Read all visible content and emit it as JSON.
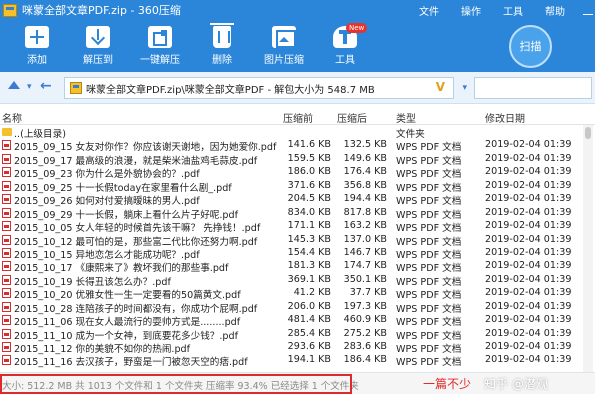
{
  "window": {
    "title": "咪蒙全部文章PDF.zip - 360压缩",
    "menus": [
      "文件",
      "操作",
      "工具",
      "帮助"
    ]
  },
  "toolbar": {
    "add": "添加",
    "extract": "解压到",
    "one_key": "一键解压",
    "delete": "删除",
    "image_compress": "图片压缩",
    "tools": "工具",
    "new_badge": "New",
    "scan": "扫描"
  },
  "address": {
    "path": "咪蒙全部文章PDF.zip\\咪蒙全部文章PDF - 解包大小为 548.7 MB",
    "v_mark": "V"
  },
  "columns": {
    "name": "名称",
    "size": "压缩前",
    "compressed": "压缩后",
    "type": "类型",
    "modified": "修改日期"
  },
  "rows": [
    {
      "icon": "folder-icon",
      "name": "..(上级目录)",
      "size": "",
      "compressed": "",
      "type": "文件夹",
      "date": ""
    },
    {
      "icon": "pdf-icon",
      "name": "2015_09_15 女友对你作？你应该谢天谢地，因为她爱你.pdf",
      "size": "141.6 KB",
      "compressed": "132.5 KB",
      "type": "WPS PDF 文档",
      "date": "2019-02-04 01:39"
    },
    {
      "icon": "pdf-icon",
      "name": "2015_09_17 最高级的浪漫，就是柴米油盐鸡毛蒜皮.pdf",
      "size": "159.5 KB",
      "compressed": "149.6 KB",
      "type": "WPS PDF 文档",
      "date": "2019-02-04 01:39"
    },
    {
      "icon": "pdf-icon",
      "name": "2015_09_23 你为什么是外貌协会的？.pdf",
      "size": "186.0 KB",
      "compressed": "176.4 KB",
      "type": "WPS PDF 文档",
      "date": "2019-02-04 01:39"
    },
    {
      "icon": "pdf-icon",
      "name": "2015_09_25 十一长假today在家里看什么剧_.pdf",
      "size": "371.6 KB",
      "compressed": "356.8 KB",
      "type": "WPS PDF 文档",
      "date": "2019-02-04 01:39"
    },
    {
      "icon": "pdf-icon",
      "name": "2015_09_26 如何对付爱搞暧昧的男人.pdf",
      "size": "204.5 KB",
      "compressed": "194.4 KB",
      "type": "WPS PDF 文档",
      "date": "2019-02-04 01:39"
    },
    {
      "icon": "pdf-icon",
      "name": "2015_09_29 十一长假，躺床上看什么片子好呢.pdf",
      "size": "834.0 KB",
      "compressed": "817.8 KB",
      "type": "WPS PDF 文档",
      "date": "2019-02-04 01:39"
    },
    {
      "icon": "pdf-icon",
      "name": "2015_10_05 女人年轻的时候首先该干嘛？ 先挣钱！.pdf",
      "size": "171.1 KB",
      "compressed": "163.2 KB",
      "type": "WPS PDF 文档",
      "date": "2019-02-04 01:39"
    },
    {
      "icon": "pdf-icon",
      "name": "2015_10_12 最可怕的是，那些富二代比你还努力啊.pdf",
      "size": "145.3 KB",
      "compressed": "137.0 KB",
      "type": "WPS PDF 文档",
      "date": "2019-02-04 01:39"
    },
    {
      "icon": "pdf-icon",
      "name": "2015_10_15 异地恋怎么才能成功呢？.pdf",
      "size": "154.4 KB",
      "compressed": "146.7 KB",
      "type": "WPS PDF 文档",
      "date": "2019-02-04 01:39"
    },
    {
      "icon": "pdf-icon",
      "name": "2015_10_17 《康熙来了》教坏我们的那些事.pdf",
      "size": "181.3 KB",
      "compressed": "174.7 KB",
      "type": "WPS PDF 文档",
      "date": "2019-02-04 01:39"
    },
    {
      "icon": "pdf-icon",
      "name": "2015_10_19 长得丑该怎么办？.pdf",
      "size": "369.1 KB",
      "compressed": "350.1 KB",
      "type": "WPS PDF 文档",
      "date": "2019-02-04 01:39"
    },
    {
      "icon": "pdf-icon",
      "name": "2015_10_20 优雅女性一生一定要看的50篇黄文.pdf",
      "size": "41.2 KB",
      "compressed": "37.7 KB",
      "type": "WPS PDF 文档",
      "date": "2019-02-04 01:39"
    },
    {
      "icon": "pdf-icon",
      "name": "2015_10_28 连陪孩子的时间都没有，你成功个屁啊.pdf",
      "size": "206.0 KB",
      "compressed": "197.3 KB",
      "type": "WPS PDF 文档",
      "date": "2019-02-04 01:39"
    },
    {
      "icon": "pdf-icon",
      "name": "2015_11_06 现在女人最流行的耍帅方式是........pdf",
      "size": "481.4 KB",
      "compressed": "460.9 KB",
      "type": "WPS PDF 文档",
      "date": "2019-02-04 01:39"
    },
    {
      "icon": "pdf-icon",
      "name": "2015_11_10 成为一个女神，到底要花多少钱？.pdf",
      "size": "285.4 KB",
      "compressed": "275.2 KB",
      "type": "WPS PDF 文档",
      "date": "2019-02-04 01:39"
    },
    {
      "icon": "pdf-icon",
      "name": "2015_11_12 你的美貌不如你的热闹.pdf",
      "size": "293.6 KB",
      "compressed": "283.6 KB",
      "type": "WPS PDF 文档",
      "date": "2019-02-04 01:39"
    },
    {
      "icon": "pdf-icon",
      "name": "2015_11_16 去汉孩子，野蛮是一门被忽天空的痞.pdf",
      "size": "194.1 KB",
      "compressed": "186.4 KB",
      "type": "WPS PDF 文档",
      "date": "2019-02-04 01:39"
    }
  ],
  "status": {
    "text": "大小: 512.2 MB 共 1013 个文件和 1 个文件夹 压缩率 93.4% 已经选择 1 个文件夹",
    "caption": "一篇不少",
    "watermark": "知乎 @潜观"
  },
  "colors": {
    "toolbar_blue": "#2b86d9",
    "highlight_red": "#e0292b",
    "pdf_red": "#d32f2f"
  }
}
